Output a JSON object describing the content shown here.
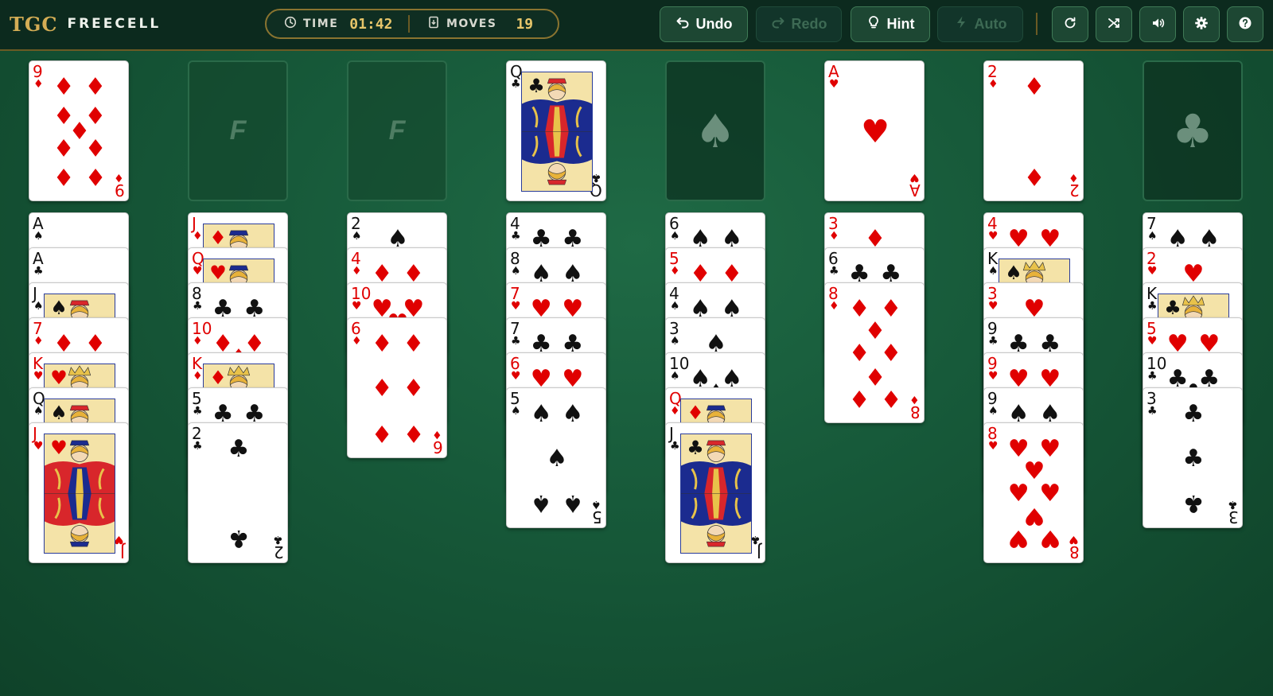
{
  "header": {
    "logo_mark": "TGC",
    "logo_text": "FREECELL",
    "time_label": "TIME",
    "time_value": "01:42",
    "moves_label": "MOVES",
    "moves_value": "19",
    "buttons": {
      "undo": "Undo",
      "redo": "Redo",
      "hint": "Hint",
      "auto": "Auto"
    },
    "icons": [
      "restart-icon",
      "shuffle-icon",
      "sound-icon",
      "settings-icon",
      "help-icon"
    ]
  },
  "colors": {
    "felt": "#175a3a",
    "header_bg": "#0c2a1e",
    "gold": "#d4ad55",
    "red_suit": "#e00000",
    "black_suit": "#111111"
  },
  "slot_labels": {
    "free_cell": "F",
    "foundation_spade": "♠",
    "foundation_club": "♣"
  },
  "free_cells": [
    {
      "rank": "9",
      "suit": "♦"
    },
    null,
    null,
    {
      "rank": "Q",
      "suit": "♣"
    }
  ],
  "foundations": [
    null,
    {
      "rank": "A",
      "suit": "♥"
    },
    {
      "rank": "2",
      "suit": "♦"
    },
    null
  ],
  "tableau": [
    [
      {
        "rank": "A",
        "suit": "♠"
      },
      {
        "rank": "A",
        "suit": "♣"
      },
      {
        "rank": "J",
        "suit": "♠"
      },
      {
        "rank": "7",
        "suit": "♦"
      },
      {
        "rank": "K",
        "suit": "♥"
      },
      {
        "rank": "Q",
        "suit": "♠"
      },
      {
        "rank": "J",
        "suit": "♥"
      }
    ],
    [
      {
        "rank": "J",
        "suit": "♦"
      },
      {
        "rank": "Q",
        "suit": "♥"
      },
      {
        "rank": "8",
        "suit": "♣"
      },
      {
        "rank": "10",
        "suit": "♦"
      },
      {
        "rank": "K",
        "suit": "♦"
      },
      {
        "rank": "5",
        "suit": "♣"
      },
      {
        "rank": "2",
        "suit": "♣"
      }
    ],
    [
      {
        "rank": "2",
        "suit": "♠"
      },
      {
        "rank": "4",
        "suit": "♦"
      },
      {
        "rank": "10",
        "suit": "♥"
      },
      {
        "rank": "6",
        "suit": "♦"
      }
    ],
    [
      {
        "rank": "4",
        "suit": "♣"
      },
      {
        "rank": "8",
        "suit": "♠"
      },
      {
        "rank": "7",
        "suit": "♥"
      },
      {
        "rank": "7",
        "suit": "♣"
      },
      {
        "rank": "6",
        "suit": "♥"
      },
      {
        "rank": "5",
        "suit": "♠"
      }
    ],
    [
      {
        "rank": "6",
        "suit": "♠"
      },
      {
        "rank": "5",
        "suit": "♦"
      },
      {
        "rank": "4",
        "suit": "♠"
      },
      {
        "rank": "3",
        "suit": "♠"
      },
      {
        "rank": "10",
        "suit": "♠"
      },
      {
        "rank": "Q",
        "suit": "♦"
      },
      {
        "rank": "J",
        "suit": "♣"
      }
    ],
    [
      {
        "rank": "3",
        "suit": "♦"
      },
      {
        "rank": "6",
        "suit": "♣"
      },
      {
        "rank": "8",
        "suit": "♦"
      }
    ],
    [
      {
        "rank": "4",
        "suit": "♥"
      },
      {
        "rank": "K",
        "suit": "♠"
      },
      {
        "rank": "3",
        "suit": "♥"
      },
      {
        "rank": "9",
        "suit": "♣"
      },
      {
        "rank": "9",
        "suit": "♥"
      },
      {
        "rank": "9",
        "suit": "♠"
      },
      {
        "rank": "8",
        "suit": "♥"
      }
    ],
    [
      {
        "rank": "7",
        "suit": "♠"
      },
      {
        "rank": "2",
        "suit": "♥"
      },
      {
        "rank": "K",
        "suit": "♣"
      },
      {
        "rank": "5",
        "suit": "♥"
      },
      {
        "rank": "10",
        "suit": "♣"
      },
      {
        "rank": "3",
        "suit": "♣"
      }
    ]
  ]
}
